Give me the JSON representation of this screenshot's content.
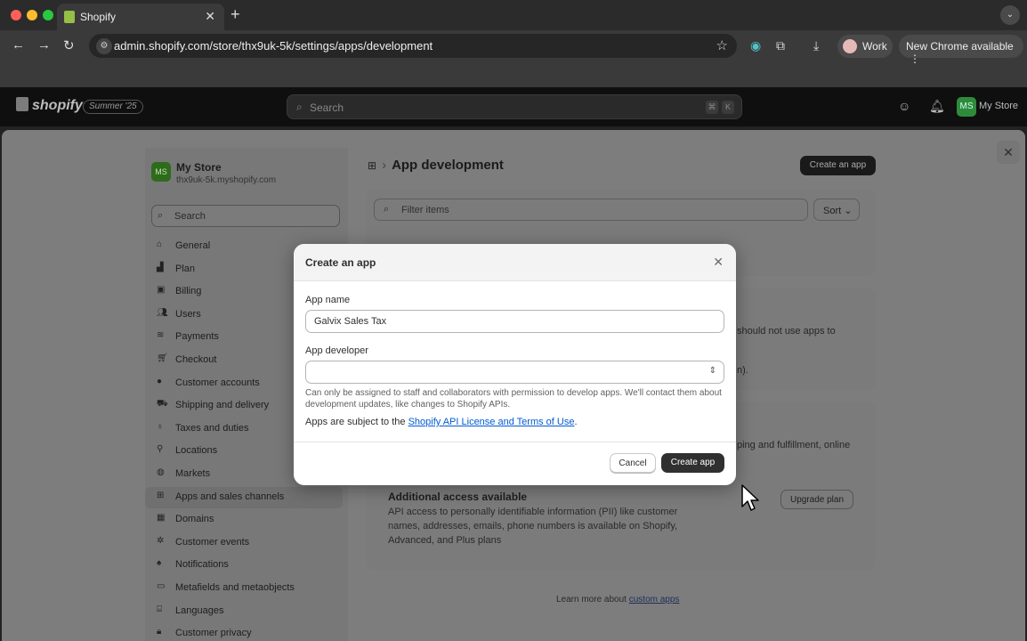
{
  "browser": {
    "tab_title": "Shopify",
    "url": "admin.shopify.com/store/thx9uk-5k/settings/apps/development",
    "profile_label": "Work",
    "update_label": "New Chrome available"
  },
  "topbar": {
    "brand": "shopify",
    "edition_badge": "Summer '25",
    "search_placeholder": "Search",
    "shortcut_keys": [
      "⌘",
      "K"
    ],
    "store_initials": "MS",
    "store_name": "My Store"
  },
  "sidebar": {
    "store_initials": "MS",
    "store_name": "My Store",
    "store_domain": "thx9uk-5k.myshopify.com",
    "search_placeholder": "Search",
    "items": [
      {
        "label": "General",
        "icon": "store-icon"
      },
      {
        "label": "Plan",
        "icon": "plan-icon"
      },
      {
        "label": "Billing",
        "icon": "billing-icon"
      },
      {
        "label": "Users",
        "icon": "users-icon"
      },
      {
        "label": "Payments",
        "icon": "payments-icon"
      },
      {
        "label": "Checkout",
        "icon": "cart-icon"
      },
      {
        "label": "Customer accounts",
        "icon": "person-icon"
      },
      {
        "label": "Shipping and delivery",
        "icon": "truck-icon"
      },
      {
        "label": "Taxes and duties",
        "icon": "tax-icon"
      },
      {
        "label": "Locations",
        "icon": "location-icon"
      },
      {
        "label": "Markets",
        "icon": "globe-icon"
      },
      {
        "label": "Apps and sales channels",
        "icon": "apps-icon",
        "selected": true
      },
      {
        "label": "Domains",
        "icon": "domains-icon"
      },
      {
        "label": "Customer events",
        "icon": "events-icon"
      },
      {
        "label": "Notifications",
        "icon": "bell-icon"
      },
      {
        "label": "Metafields and metaobjects",
        "icon": "metafields-icon"
      },
      {
        "label": "Languages",
        "icon": "languages-icon"
      },
      {
        "label": "Customer privacy",
        "icon": "lock-icon"
      }
    ]
  },
  "main": {
    "page_title": "App development",
    "create_app_button": "Create an app",
    "filter_placeholder": "Filter items",
    "sort_label": "Sort",
    "partial_text_1": "should not use apps to",
    "partial_text_2": "n).",
    "partial_text_3": "ping and fulfillment, online",
    "additional_access_title": "Additional access available",
    "additional_access_desc": "API access to personally identifiable information (PII) like customer names, addresses, emails, phone numbers is available on Shopify, Advanced, and Plus plans",
    "upgrade_button": "Upgrade plan",
    "learn_more_prefix": "Learn more about",
    "learn_more_link": "custom apps"
  },
  "modal": {
    "title": "Create an app",
    "app_name_label": "App name",
    "app_name_value": "Galvix Sales Tax",
    "app_developer_label": "App developer",
    "app_developer_value": "",
    "help_text": "Can only be assigned to staff and collaborators with permission to develop apps. We'll contact them about development updates, like changes to Shopify APIs.",
    "terms_prefix": "Apps are subject to the",
    "terms_link": "Shopify API License and Terms of Use",
    "terms_suffix": ".",
    "cancel_button": "Cancel",
    "create_button": "Create app"
  },
  "colors": {
    "accent_link": "#005bd3",
    "primary_button": "#303030",
    "store_avatar": "#2f8b3c"
  }
}
